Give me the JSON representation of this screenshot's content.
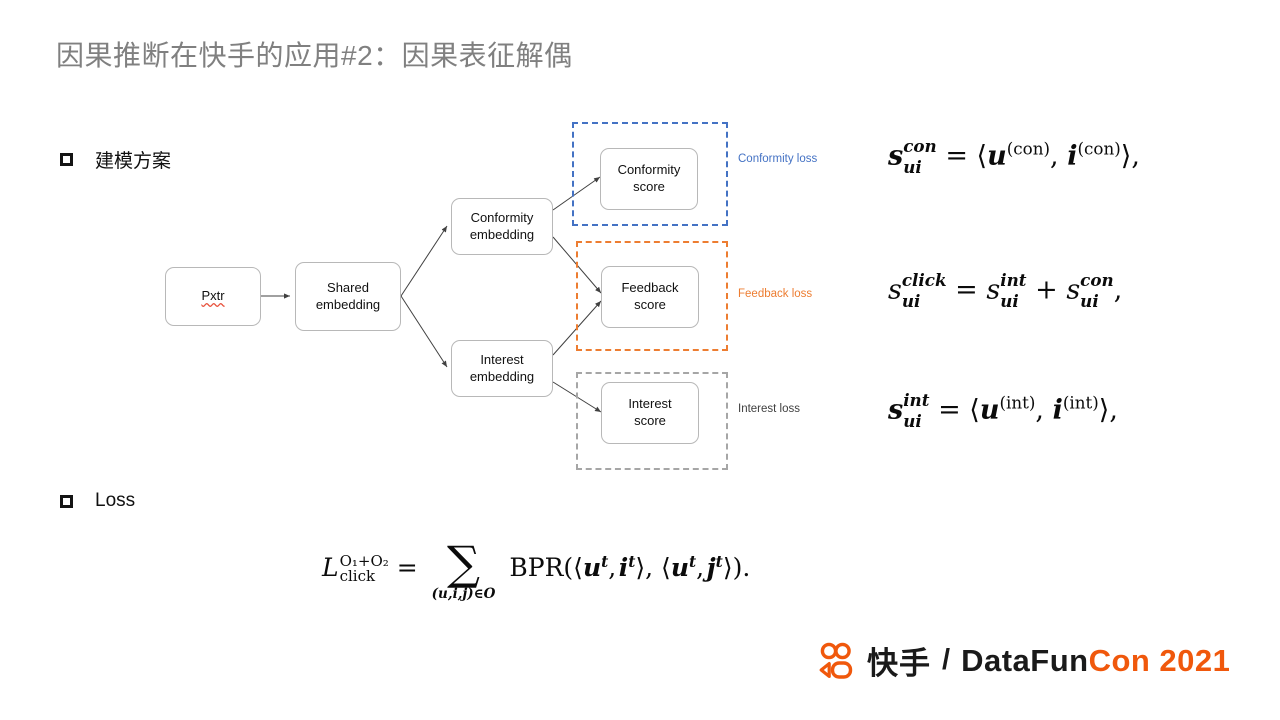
{
  "slide": {
    "title": "因果推断在快手的应用#2：因果表征解偶"
  },
  "bullets": [
    {
      "label": "建模方案"
    },
    {
      "label": "Loss"
    }
  ],
  "diagram": {
    "nodes": [
      {
        "id": "pxtr",
        "lines": [
          "Pxtr"
        ],
        "misspelled": true
      },
      {
        "id": "shared-embedding",
        "lines": [
          "Shared",
          "embedding"
        ]
      },
      {
        "id": "conformity-embedding",
        "lines": [
          "Conformity",
          "embedding"
        ]
      },
      {
        "id": "interest-embedding",
        "lines": [
          "Interest",
          "embedding"
        ]
      },
      {
        "id": "conformity-score",
        "lines": [
          "Conformity",
          "score"
        ]
      },
      {
        "id": "feedback-score",
        "lines": [
          "Feedback",
          "score"
        ]
      },
      {
        "id": "interest-score",
        "lines": [
          "Interest",
          "score"
        ]
      }
    ],
    "loss_labels": [
      {
        "id": "conformity-loss",
        "text": "Conformity loss",
        "color": "#4472c4"
      },
      {
        "id": "feedback-loss",
        "text": "Feedback loss",
        "color": "#ed7d31"
      },
      {
        "id": "interest-loss",
        "text": "Interest loss",
        "color": "#404040"
      }
    ],
    "group_colors": {
      "conformity": "#4472c4",
      "feedback": "#ed7d31",
      "interest": "#a6a6a6"
    },
    "node_border_color": "#b8b8b8",
    "arrow_color": "#404040",
    "spellcheck_underline_color": "#e8543f"
  },
  "equations": {
    "conformity": {
      "lhs_base": "s",
      "lhs_sup": "con",
      "lhs_sub": "ui",
      "rel": "=",
      "rhs_plain": "⟨u(con), i(con)⟩,",
      "vec_u": "u",
      "vec_i": "i",
      "tag": "(con)"
    },
    "click": {
      "lhs_base": "s",
      "lhs_sup": "click",
      "lhs_sub": "ui",
      "rel": "=",
      "term1_sup": "int",
      "term2_sup": "con",
      "sub": "ui",
      "op": "+",
      "trailing": ","
    },
    "interest": {
      "lhs_base": "s",
      "lhs_sup": "int",
      "lhs_sub": "ui",
      "rel": "=",
      "vec_u": "u",
      "vec_i": "i",
      "tag": "(int)",
      "trailing": ","
    },
    "loss": {
      "lhs_base": "L",
      "lhs_sup": "O₁+O₂",
      "lhs_sub": "click",
      "rel": "=",
      "sum_glyph": "∑",
      "sum_limit": "(u,i,j)∈O",
      "func": "BPR",
      "arg1": "⟨u t, i t⟩",
      "arg2": "⟨u t, j t⟩",
      "trailing": ")."
    }
  },
  "footer_logo": {
    "brand_cn": "快手",
    "separator": "/",
    "wordmark_dark": "DataFun",
    "wordmark_orange": "Con 2021",
    "icon": "kuaishou-camera-icon",
    "accent_color": "#f0580c"
  }
}
